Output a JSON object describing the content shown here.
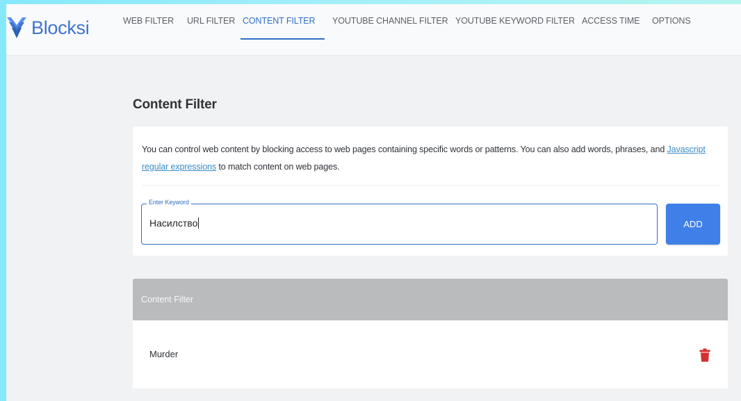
{
  "app": {
    "brand_name": "Blocksi",
    "logo_icon": "blocksi-logo-icon",
    "brand_color": "#3f74cf"
  },
  "nav": {
    "items": [
      {
        "label": "WEB FILTER"
      },
      {
        "label": "URL FILTER"
      },
      {
        "label": "CONTENT FILTER",
        "active": true
      },
      {
        "label": "YOUTUBE CHANNEL FILTER"
      },
      {
        "label": "YOUTUBE KEYWORD FILTER"
      },
      {
        "label": "ACCESS TIME"
      },
      {
        "label": "OPTIONS"
      }
    ],
    "active_color": "#2f6fc4"
  },
  "main": {
    "title": "Content Filter",
    "description_before": "You can control web content by blocking access to web pages containing specific words or patterns. You can also add words, phrases, and ",
    "description_link": "Javascript regular expressions",
    "description_after": " to match content on web pages.",
    "keyword_field": {
      "label": "Enter Keyword",
      "value": "Насилство"
    },
    "add_button_label": "ADD",
    "add_button_color": "#3f80e8"
  },
  "list": {
    "header": "Content Filter",
    "items": [
      {
        "label": "Murder",
        "action_icon": "trash-icon",
        "action_color": "#d32f2f"
      }
    ]
  }
}
